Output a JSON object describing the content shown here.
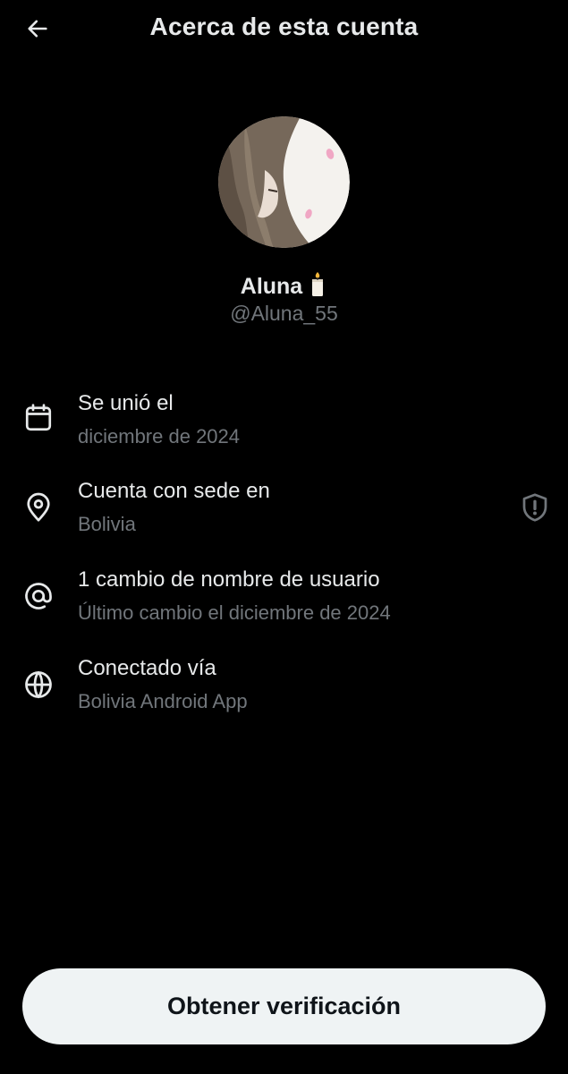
{
  "header": {
    "title": "Acerca de esta cuenta",
    "back_icon": "arrow-left-icon"
  },
  "profile": {
    "display_name": "Aluna",
    "emoji": "🕯️",
    "handle": "@Aluna_55"
  },
  "info": [
    {
      "icon": "calendar-icon",
      "title": "Se unió el",
      "subtitle": "diciembre de 2024"
    },
    {
      "icon": "location-pin-icon",
      "title": "Cuenta con sede en",
      "subtitle": "Bolivia",
      "extra_icon": "shield-alert-icon"
    },
    {
      "icon": "at-sign-icon",
      "title": "1 cambio de nombre de usuario",
      "subtitle": "Último cambio el diciembre de 2024"
    },
    {
      "icon": "globe-icon",
      "title": "Conectado vía",
      "subtitle": "Bolivia Android App"
    }
  ],
  "cta": {
    "label": "Obtener verificación"
  },
  "colors": {
    "background": "#000000",
    "primary_text": "#e7e9ea",
    "secondary_text": "#71767b",
    "button_bg": "#eff3f4",
    "button_text": "#0f1419"
  }
}
